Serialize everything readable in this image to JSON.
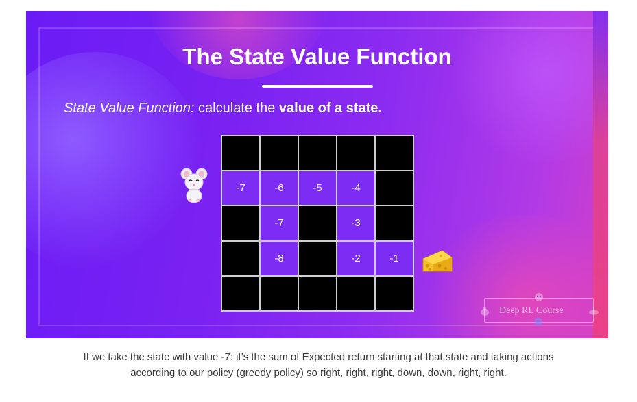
{
  "slide": {
    "title": "The State Value Function",
    "subtitle_italic": "State Value Function:",
    "subtitle_middle": " calculate the ",
    "subtitle_bold": "value of a state.",
    "grid": [
      [
        "",
        "",
        "",
        "",
        ""
      ],
      [
        "-7",
        "-6",
        "-5",
        "-4",
        ""
      ],
      [
        "",
        "-7",
        "",
        "-3",
        ""
      ],
      [
        "",
        "-8",
        "",
        "-2",
        "-1"
      ],
      [
        "",
        "",
        "",
        "",
        ""
      ]
    ],
    "open_cells": [
      [
        false,
        false,
        false,
        false,
        false
      ],
      [
        true,
        true,
        true,
        true,
        false
      ],
      [
        false,
        true,
        false,
        true,
        false
      ],
      [
        false,
        true,
        false,
        true,
        true
      ],
      [
        false,
        false,
        false,
        false,
        false
      ]
    ],
    "icons": [
      "mouse-icon",
      "cheese-icon"
    ],
    "logo_text": "Deep RL Course",
    "colors": {
      "background_start": "#6a1bf5",
      "background_end": "#d240c8",
      "open_cell": "#7d2cf4",
      "wall_cell": "#000000",
      "grid_lines": "#cfcfcf"
    }
  },
  "caption": {
    "line1": "If we take the state with value -7: it’s the sum of Expected return starting at that state and taking actions",
    "line2": "according to our policy (greedy policy) so right, right, right, down, down, right, right."
  }
}
